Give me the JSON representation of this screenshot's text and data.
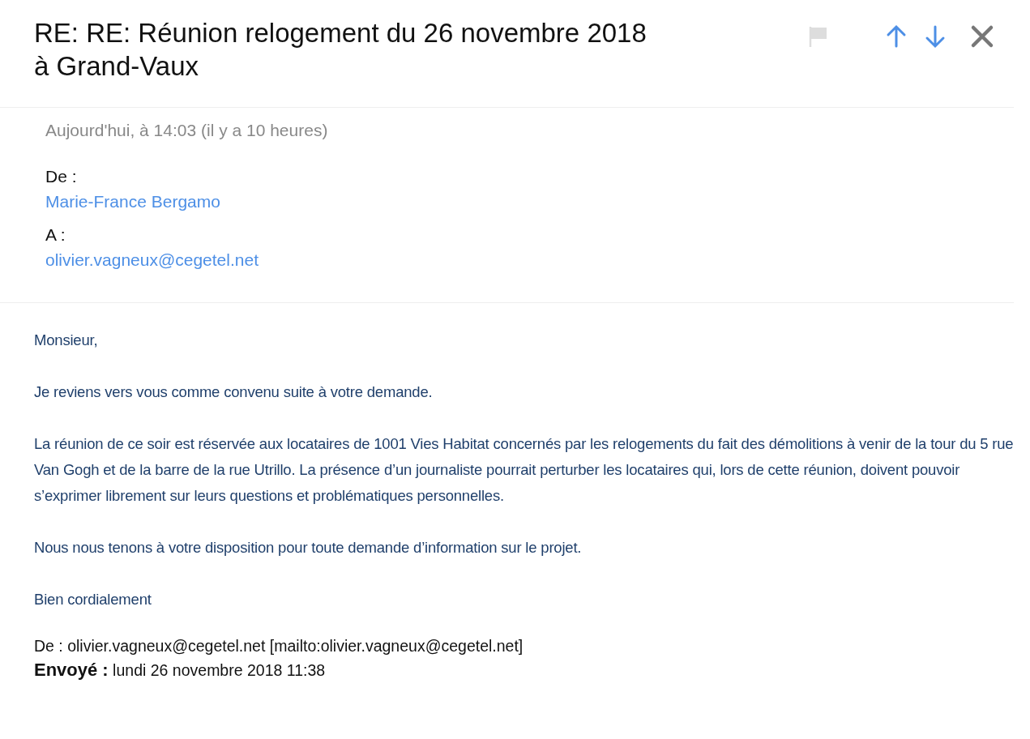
{
  "header": {
    "subject": "RE: RE: Réunion relogement du 26 novembre 2018 à Grand-Vaux",
    "flagged": false
  },
  "meta": {
    "date": "Aujourd'hui, à 14:03 (il y a 10 heures)",
    "fields": [
      {
        "label": "De :",
        "value": "Marie-France Bergamo"
      },
      {
        "label": "A :",
        "value": "olivier.vagneux@cegetel.net"
      }
    ]
  },
  "body": {
    "paragraphs": [
      "Monsieur,",
      "Je reviens vers vous  comme convenu suite à votre demande.",
      "La réunion de ce soir est réservée aux locataires de 1001 Vies Habitat concernés par les relogements du fait des démolitions à venir de la tour du 5 rue Van Gogh et de la barre de la rue Utrillo. La présence d’un journaliste pourrait perturber les locataires qui, lors de cette réunion, doivent pouvoir s’exprimer librement sur leurs questions et problématiques personnelles.",
      "Nous nous tenons à votre disposition pour toute demande d’information sur le projet.",
      "Bien cordialement"
    ],
    "quoted": [
      "De : olivier.vagneux@cegetel.net [mailto:olivier.vagneux@cegetel.net]",
      "**Envoyé :** lundi 26 novembre 2018 11:38"
    ]
  }
}
